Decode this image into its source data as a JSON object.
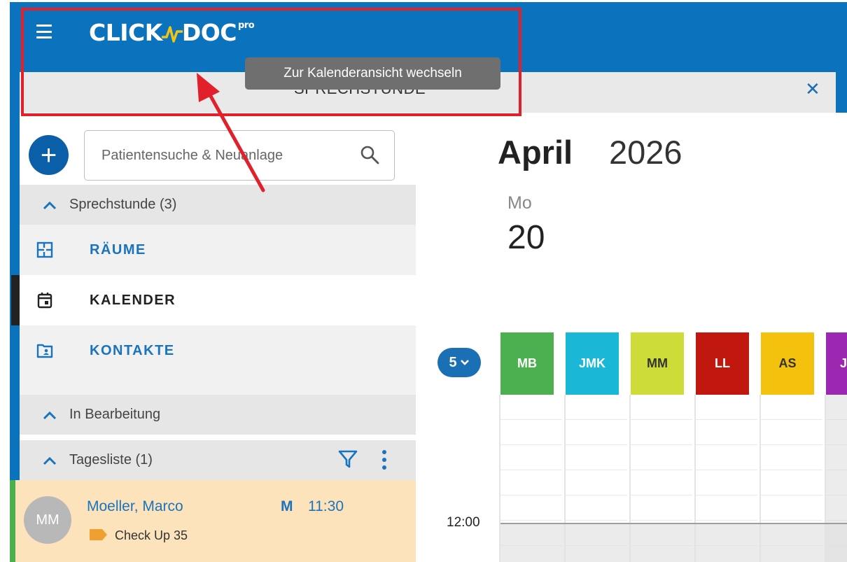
{
  "app": {
    "logo_text_left": "CLICK",
    "logo_text_right": "DOC",
    "logo_superscript": "pro"
  },
  "tab": {
    "label": "SPRECHSTUNDE",
    "close_glyph": "✕"
  },
  "tooltip": {
    "text": "Zur Kalenderansicht wechseln"
  },
  "search": {
    "placeholder": "Patientensuche & Neuanlage"
  },
  "add_button": {
    "glyph": "+"
  },
  "sidebar": {
    "sprechstunde_header": "Sprechstunde (3)",
    "nav": [
      {
        "label": "RÄUME",
        "icon": "floorplan-icon"
      },
      {
        "label": "KALENDER",
        "icon": "calendar-icon"
      },
      {
        "label": "KONTAKTE",
        "icon": "contacts-folder-icon"
      }
    ],
    "in_bearbeitung_header": "In Bearbeitung",
    "tagesliste_header": "Tagesliste (1)"
  },
  "patient": {
    "initials": "MM",
    "name": "Moeller, Marco",
    "doctor": "M",
    "time": "11:30",
    "appointment": "Check Up 35",
    "tag_color": "#f0a030",
    "status_color": "#4bb14a"
  },
  "calendar": {
    "month": "April",
    "year": "2026",
    "weekday": "Mo",
    "day": "20",
    "resource_count": "5",
    "columns": [
      {
        "label": "MB",
        "color": "#4caf50"
      },
      {
        "label": "JMK",
        "color": "#1ab7d6"
      },
      {
        "label": "MM",
        "color": "#cddc39"
      },
      {
        "label": "LL",
        "color": "#c0170e"
      },
      {
        "label": "AS",
        "color": "#f4c20d"
      },
      {
        "label": "J",
        "color": "#9c27b0"
      }
    ],
    "time_label": "12:00"
  },
  "colors": {
    "brand_blue": "#0b72bd",
    "highlight_red": "#e2202b"
  }
}
